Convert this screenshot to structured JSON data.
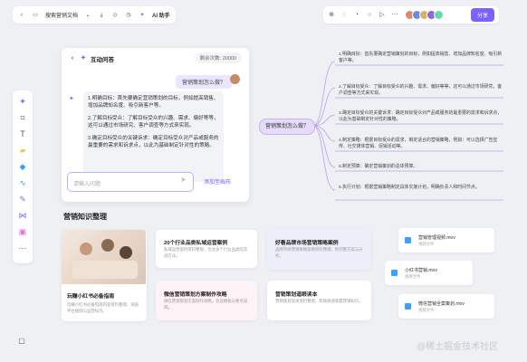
{
  "topbar": {
    "doc_title": "搜索营销文档",
    "ai_label": "AI 助手",
    "share_label": "分享"
  },
  "chat": {
    "title": "互动问答",
    "credits": "剩余次数: 20000",
    "question": "营销策划怎么做？",
    "answer": [
      "1.明确目标：首先要确定营销策划的目标，例如提高销售、增加品牌知名度、吸引新客户等。",
      "2.了解目标受众：了解目标受众的兴趣、需求、偏好等等，这可以通过市场研究、客户调查等方式来实现。",
      "3.确定目标受众的关键诉求：确定目标受众对产品或服务的最重要的需求和诉求点，以此为基础制定针对性的策略。"
    ],
    "input_placeholder": "请输入问题",
    "add_to_canvas": "添加至画布"
  },
  "mindmap": {
    "center": "营销策划怎么做？",
    "items": [
      "1.明确目标：首先要确定营销策划的目标，例如提高销售、增加品牌知名度、吸引新客户等。",
      "2.了解目标受众：了解目标受众的兴趣、需求、偏好等等，这可以通过市场研究、客户调查等方式来实现。",
      "3.确定目标受众的关键诉求：确定目标受众对产品或服务的最重要的需求和诉求点，以此为基础制定针对性的策略。",
      "4.制定策略：根据目标受众的需求，制定适合的营销策略，例如：可以选择广告宣传、社交媒体营销、促销活动等。",
      "5.制定预算：确定营销策划的总体预算。",
      "6.执行计划：根据营销策略制定具体实施计划，明确负责人和时间节点。"
    ]
  },
  "knowledge": {
    "section_title": "营销知识整理",
    "cards": [
      {
        "title": "玩赚小红书必备指南",
        "desc": "玩赚小红书必备指南内容资料整理，涵盖平台规则与运营技巧。"
      },
      {
        "title": "20个行业品类私域运营案例",
        "desc": "私域运营案例资料整理，包含多个行业品类的实战方法。"
      },
      {
        "title": "好看品牌市场营销策略案例",
        "desc": "品牌市场营销策略案例资料整理，附完整方案与分析。"
      },
      {
        "title": "微信营销策划方案制作攻略",
        "desc": "微信营销策划方案制作攻略，包含模板与要点说明。"
      },
      {
        "title": "营销策划道眼读本",
        "desc": "营销策划读本资料整理，帮助快速掌握营销知识。"
      }
    ],
    "files": [
      {
        "name": "营销管理视频.mov",
        "desc": "视频文件"
      },
      {
        "name": "小红书营销.mov",
        "desc": "视频文件"
      },
      {
        "name": "微信营销全案策划.mov",
        "desc": "视频文件"
      }
    ]
  },
  "watermark": "@稀土掘金技术社区",
  "colors": {
    "accent": "#7b61ff",
    "mindmap_line": "#b9a0f0"
  }
}
